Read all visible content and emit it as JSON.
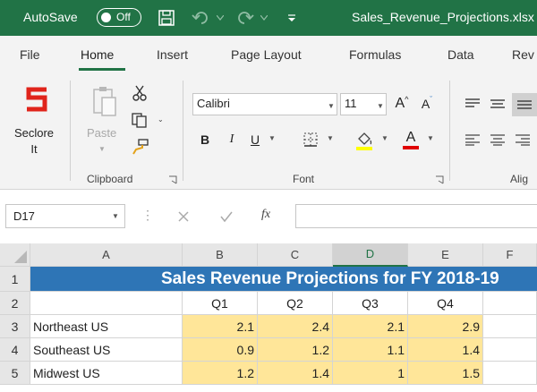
{
  "titlebar": {
    "autosave_label": "AutoSave",
    "autosave_state": "Off",
    "filename": "Sales_Revenue_Projections.xlsx"
  },
  "tabs": [
    "File",
    "Home",
    "Insert",
    "Page Layout",
    "Formulas",
    "Data",
    "Rev"
  ],
  "active_tab": "Home",
  "ribbon": {
    "seclore_line1": "Seclore",
    "seclore_line2": "It",
    "paste_label": "Paste",
    "clipboard_label": "Clipboard",
    "font_name": "Calibri",
    "font_size": "11",
    "font_label": "Font",
    "alignment_label": "Alig",
    "bold": "B",
    "italic": "I",
    "underline": "U",
    "font_color_glyph": "A",
    "grow_glyph": "A",
    "shrink_glyph": "A",
    "fill_color": "#ffff00",
    "font_color": "#e00000"
  },
  "formula_bar": {
    "name_box": "D17",
    "fx": "fx",
    "formula": ""
  },
  "sheet": {
    "columns": [
      "A",
      "B",
      "C",
      "D",
      "E",
      "F"
    ],
    "selected_column": "D",
    "rows": [
      "1",
      "2",
      "3",
      "4",
      "5"
    ],
    "title": "Sales Revenue Projections for FY 2018-19",
    "quarters": [
      "Q1",
      "Q2",
      "Q3",
      "Q4"
    ],
    "regions": [
      {
        "name": "Northeast US",
        "values": [
          "2.1",
          "2.4",
          "2.1",
          "2.9"
        ]
      },
      {
        "name": "Southeast US",
        "values": [
          "0.9",
          "1.2",
          "1.1",
          "1.4"
        ]
      },
      {
        "name": "Midwest US",
        "values": [
          "1.2",
          "1.4",
          "1",
          "1.5"
        ]
      }
    ],
    "colors": {
      "banner": "#2e75b6",
      "data_fill": "#ffe699",
      "accent": "#217346"
    }
  }
}
